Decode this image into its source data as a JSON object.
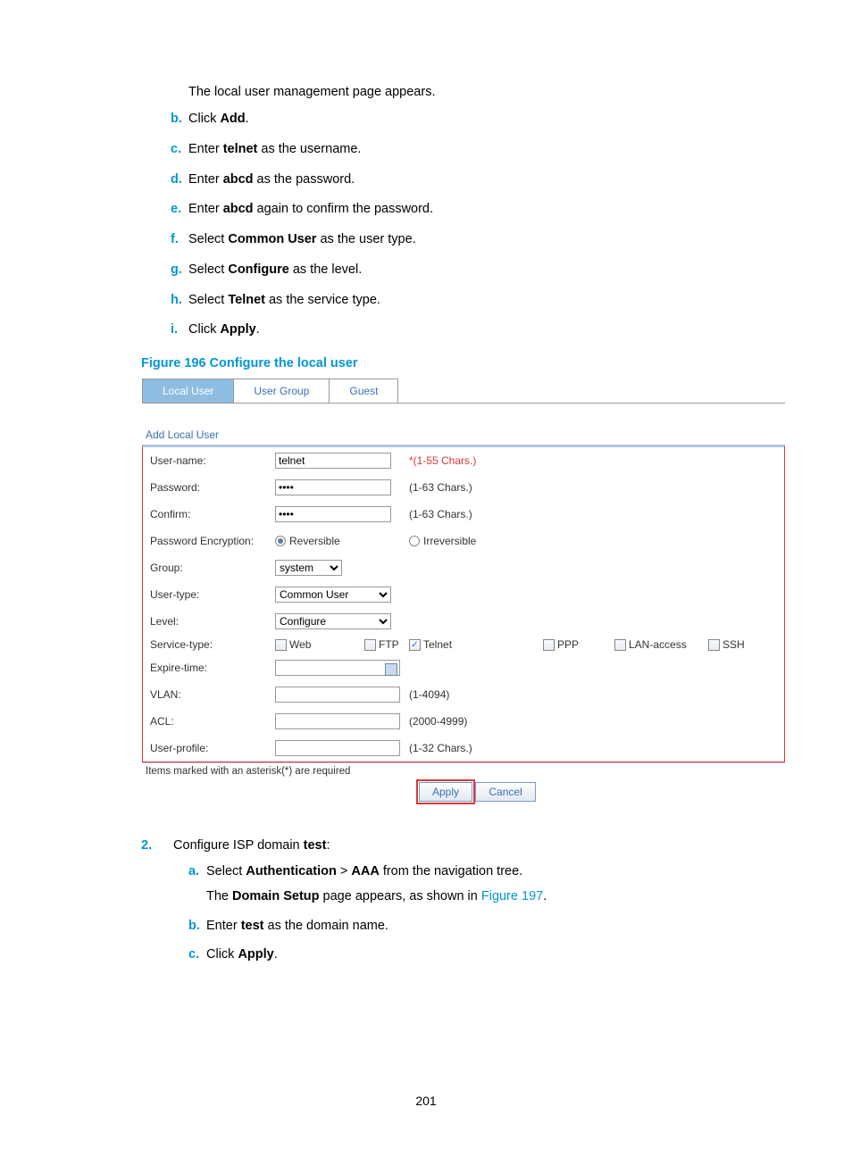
{
  "intro": "The local user management page appears.",
  "steps1": [
    {
      "b": "b.",
      "pre": "Click ",
      "bold": "Add",
      "post": "."
    },
    {
      "b": "c.",
      "pre": "Enter ",
      "bold": "telnet",
      "post": " as the username."
    },
    {
      "b": "d.",
      "pre": "Enter ",
      "bold": "abcd",
      "post": " as the password."
    },
    {
      "b": "e.",
      "pre": "Enter ",
      "bold": "abcd",
      "post": " again to confirm the password."
    },
    {
      "b": "f.",
      "pre": "Select ",
      "bold": "Common User",
      "post": " as the user type."
    },
    {
      "b": "g.",
      "pre": "Select ",
      "bold": "Configure",
      "post": " as the level."
    },
    {
      "b": "h.",
      "pre": "Select ",
      "bold": "Telnet",
      "post": " as the service type."
    },
    {
      "b": "i.",
      "pre": "Click ",
      "bold": "Apply",
      "post": "."
    }
  ],
  "figure_caption": "Figure 196 Configure the local user",
  "tabs": [
    "Local User",
    "User Group",
    "Guest"
  ],
  "section_title": "Add Local User",
  "form": {
    "username": {
      "label": "User-name:",
      "value": "telnet",
      "hint": "*(1-55 Chars.)"
    },
    "password": {
      "label": "Password:",
      "value": "abcd",
      "hint": "(1-63 Chars.)"
    },
    "confirm": {
      "label": "Confirm:",
      "value": "abcd",
      "hint": "(1-63 Chars.)"
    },
    "encryption": {
      "label": "Password Encryption:",
      "opt1": "Reversible",
      "opt2": "Irreversible"
    },
    "group": {
      "label": "Group:",
      "value": "system"
    },
    "usertype": {
      "label": "User-type:",
      "value": "Common User"
    },
    "level": {
      "label": "Level:",
      "value": "Configure"
    },
    "service": {
      "label": "Service-type:",
      "opts": [
        "Web",
        "FTP",
        "Telnet",
        "PPP",
        "LAN-access",
        "SSH"
      ],
      "checked_index": 2
    },
    "expire": {
      "label": "Expire-time:"
    },
    "vlan": {
      "label": "VLAN:",
      "hint": "(1-4094)"
    },
    "acl": {
      "label": "ACL:",
      "hint": "(2000-4999)"
    },
    "profile": {
      "label": "User-profile:",
      "hint": "(1-32 Chars.)"
    },
    "required_note": "Items marked with an asterisk(*) are required",
    "apply": "Apply",
    "cancel": "Cancel"
  },
  "step2": {
    "num": "2.",
    "lead_pre": "Configure ISP domain ",
    "lead_bold": "test",
    "lead_post": ":",
    "a": {
      "b": "a.",
      "pre": "Select ",
      "bold1": "Authentication",
      "mid": " > ",
      "bold2": "AAA",
      "post": " from the navigation tree."
    },
    "a_desc_pre": "The ",
    "a_desc_bold": "Domain Setup",
    "a_desc_mid": " page appears, as shown in ",
    "a_desc_link": "Figure 197",
    "a_desc_post": ".",
    "b": {
      "b": "b.",
      "pre": "Enter ",
      "bold": "test",
      "post": " as the domain name."
    },
    "c": {
      "b": "c.",
      "pre": "Click ",
      "bold": "Apply",
      "post": "."
    }
  },
  "page_number": "201"
}
